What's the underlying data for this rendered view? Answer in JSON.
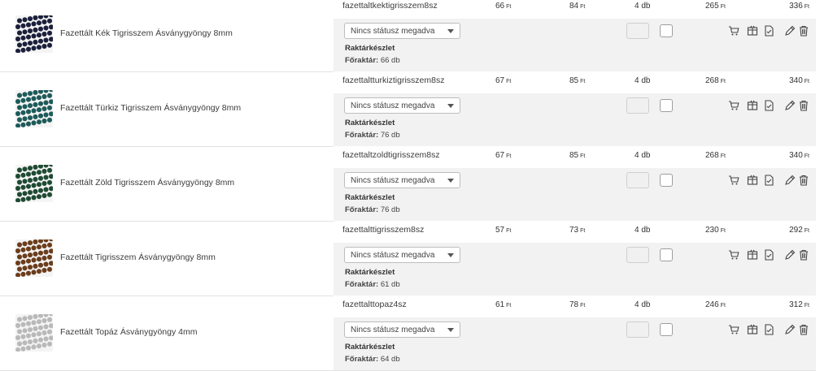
{
  "products": [
    {
      "name": "Fazettált Kék Tigrisszem Ásványgyöngy 8mm",
      "sku": "fazettaltkektigrisszem8sz",
      "price1": "66",
      "price2": "84",
      "qty": "4 db",
      "total1": "265",
      "total2": "336",
      "status": "Nincs státusz megadva",
      "stock_label": "Raktárkészlet",
      "stock_key": "Főraktár:",
      "stock_value": "66 db",
      "bead_color": "#1b1f3a"
    },
    {
      "name": "Fazettált Türkiz Tigrisszem Ásványgyöngy 8mm",
      "sku": "fazettaltturkiztigrisszem8sz",
      "price1": "67",
      "price2": "85",
      "qty": "4 db",
      "total1": "268",
      "total2": "340",
      "status": "Nincs státusz megadva",
      "stock_label": "Raktárkészlet",
      "stock_key": "Főraktár:",
      "stock_value": "76 db",
      "bead_color": "#1e5a5a"
    },
    {
      "name": "Fazettált Zöld Tigrisszem Ásványgyöngy 8mm",
      "sku": "fazettaltzoldtigrisszem8sz",
      "price1": "67",
      "price2": "85",
      "qty": "4 db",
      "total1": "268",
      "total2": "340",
      "status": "Nincs státusz megadva",
      "stock_label": "Raktárkészlet",
      "stock_key": "Főraktár:",
      "stock_value": "76 db",
      "bead_color": "#1f4a33"
    },
    {
      "name": "Fazettált Tigrisszem Ásványgyöngy 8mm",
      "sku": "fazettalttigrisszem8sz",
      "price1": "57",
      "price2": "73",
      "qty": "4 db",
      "total1": "230",
      "total2": "292",
      "status": "Nincs státusz megadva",
      "stock_label": "Raktárkészlet",
      "stock_key": "Főraktár:",
      "stock_value": "61 db",
      "bead_color": "#6b3d1c"
    },
    {
      "name": "Fazettált Topáz Ásványgyöngy 4mm",
      "sku": "fazettalttopaz4sz",
      "price1": "61",
      "price2": "78",
      "qty": "4 db",
      "total1": "246",
      "total2": "312",
      "status": "Nincs státusz megadva",
      "stock_label": "Raktárkészlet",
      "stock_key": "Főraktár:",
      "stock_value": "64 db",
      "bead_color": "#b9b9b9"
    }
  ],
  "currency": "Ft",
  "icons": [
    "cart-icon",
    "box-icon",
    "document-check-icon",
    "pencil-icon",
    "trash-icon"
  ]
}
